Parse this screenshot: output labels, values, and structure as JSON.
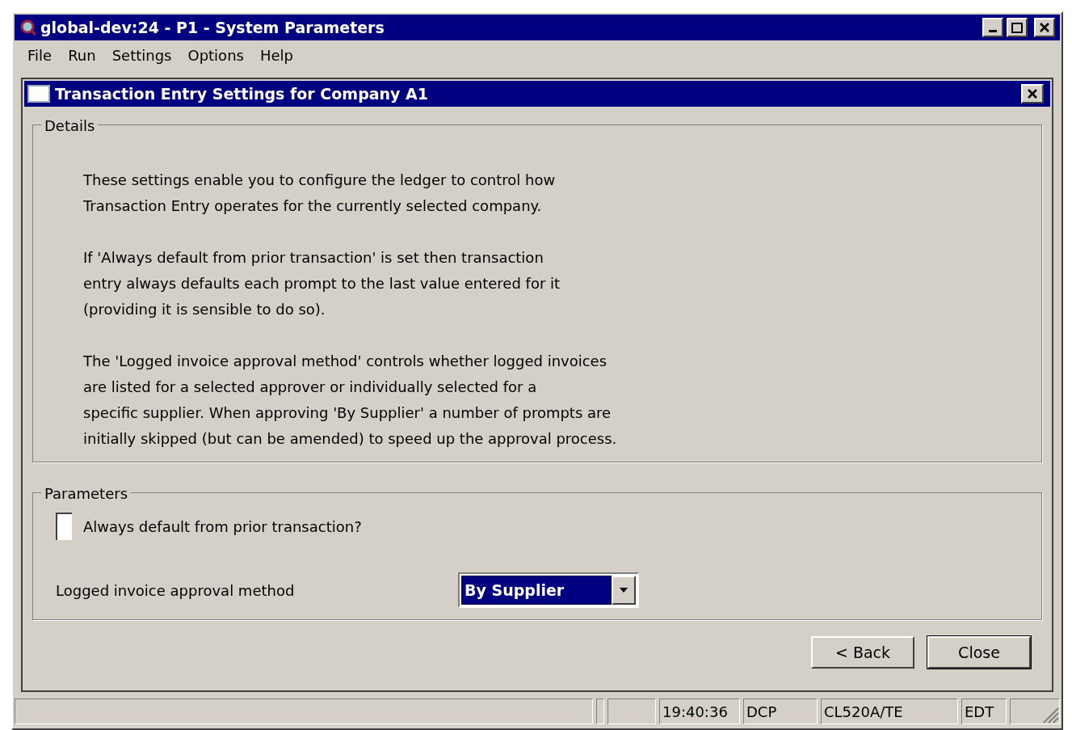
{
  "window": {
    "title": "global-dev:24 - P1 - System Parameters"
  },
  "menu": [
    "File",
    "Run",
    "Settings",
    "Options",
    "Help"
  ],
  "dialog": {
    "title": "Transaction Entry Settings for Company A1"
  },
  "details": {
    "legend": "Details",
    "paragraphs": [
      "These settings enable you to configure the ledger to control how\nTransaction Entry operates for the currently selected company.",
      "If 'Always default from prior transaction' is set then transaction\nentry always defaults each prompt to the last value entered for it\n(providing it is sensible to do so).",
      "The 'Logged invoice approval method' controls whether logged invoices\nare listed for a selected approver or individually selected for a\nspecific supplier.  When approving 'By Supplier' a number of prompts are\ninitially skipped (but can be amended) to speed up the approval process."
    ]
  },
  "parameters": {
    "legend": "Parameters",
    "checkbox": {
      "label": "Always default from prior transaction?",
      "checked": false
    },
    "approval": {
      "label": "Logged invoice approval method",
      "value": "By Supplier"
    }
  },
  "buttons": [
    {
      "label": "< Back",
      "default": false
    },
    {
      "label": "Close",
      "default": true
    }
  ],
  "status_bar": [
    "19:40:36",
    "DCP",
    "CL520A/TE",
    "EDT"
  ]
}
